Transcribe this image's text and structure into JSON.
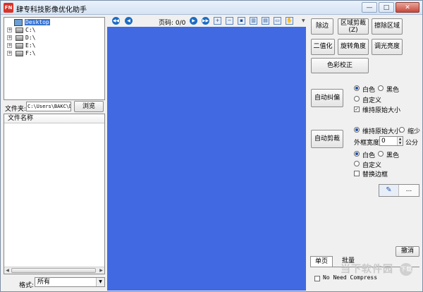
{
  "window": {
    "title": "肆专科技影像优化助手",
    "icon_text": "FN",
    "minimize_glyph": "—",
    "maximize_glyph": "□",
    "close_glyph": "✕"
  },
  "tree": {
    "root": "Desktop",
    "drives": [
      "C:\\",
      "D:\\",
      "E:\\",
      "F:\\"
    ]
  },
  "folder": {
    "label": "文件夹:",
    "path": "C:\\Users\\BAKC\\D",
    "browse": "浏览"
  },
  "filelist": {
    "header": "文件名称"
  },
  "format": {
    "label": "格式:",
    "value": "所有"
  },
  "toolbar": {
    "page_label": "页码:",
    "page_value": "0/0"
  },
  "right": {
    "btn_edge": "除边",
    "btn_region_crop": "区域剪裁(Z)",
    "btn_erase": "擦除区域",
    "btn_binarize": "二值化",
    "btn_rotate": "旋转角度",
    "btn_brightness": "调光亮度",
    "btn_color": "色彩校正",
    "btn_deskew": "自动纠偏",
    "deskew_white": "白色",
    "deskew_black": "黑色",
    "deskew_custom": "自定义",
    "deskew_keep": "维持原始大小",
    "btn_autocrop": "自动剪裁",
    "crop_keep": "维持原始大小",
    "crop_shrink": "缩少",
    "border_label": "外框宽度",
    "border_value": "0",
    "border_unit": "公分",
    "crop_white": "白色",
    "crop_black": "黑色",
    "crop_custom": "自定义",
    "replace_border": "替换边框",
    "dots": "...",
    "btn_undo": "撤消",
    "tab_single": "单页",
    "tab_batch": "批量",
    "no_compress": "No Need Compress"
  },
  "watermark": {
    "text": "当下软件园",
    "badge": "下载"
  },
  "icons": {
    "nav_first": "first-page-icon",
    "nav_prev": "prev-page-icon",
    "nav_next": "next-page-icon",
    "nav_last": "last-page-icon",
    "zoom_in": "zoom-in-icon",
    "zoom_out": "zoom-out-icon",
    "save": "save-icon",
    "fit": "fit-page-icon",
    "dual": "dual-page-icon",
    "pencil": "pencil-icon"
  },
  "colors": {
    "canvas": "#4169e1",
    "accent": "#1b6cc4",
    "selection": "#3372d4"
  }
}
